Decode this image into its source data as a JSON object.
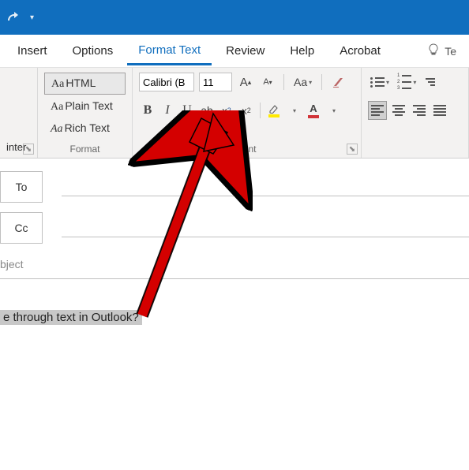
{
  "tabs": {
    "insert": "Insert",
    "options": "Options",
    "format_text": "Format Text",
    "review": "Review",
    "help": "Help",
    "acrobat": "Acrobat",
    "tell_me": "Te"
  },
  "clipboard": {
    "label": "inter"
  },
  "format": {
    "html": "HTML",
    "plain": "Plain Text",
    "rich": "Rich Text",
    "label": "Format"
  },
  "font": {
    "name": "Calibri (B",
    "size": "11",
    "grow_a": "A",
    "shrink_a": "A",
    "change_case": "Aa",
    "bold": "B",
    "italic": "I",
    "underline": "U",
    "strike": "ab",
    "sub_x": "x",
    "sub_2": "2",
    "sup_x": "x",
    "sup_2": "2",
    "font_color_a": "A",
    "label": "Font"
  },
  "compose": {
    "to": "To",
    "cc": "Cc",
    "subject_label": "bject"
  },
  "body": {
    "selected": "e through text in Outlook?"
  }
}
